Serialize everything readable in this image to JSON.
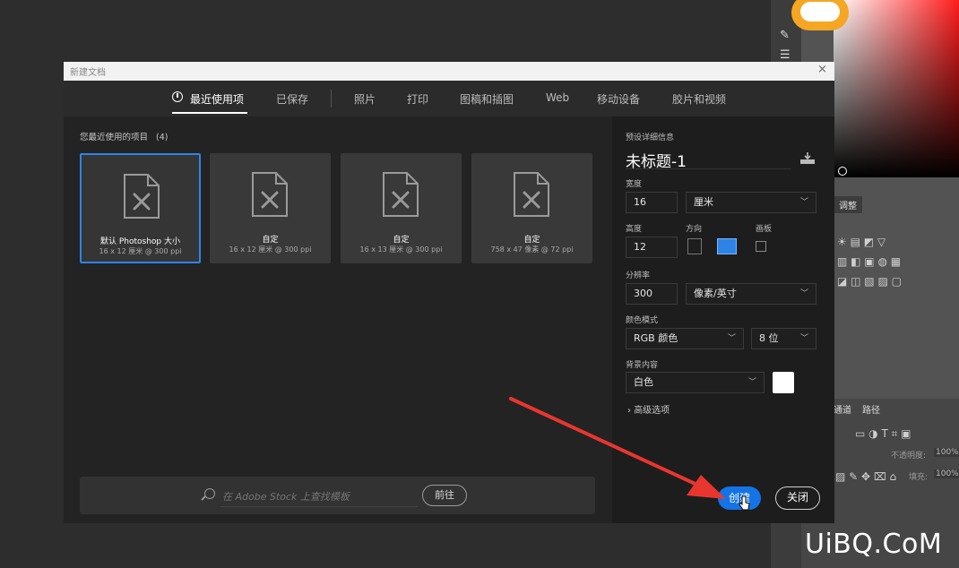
{
  "dialog": {
    "title": "新建文档",
    "close_glyph": "×"
  },
  "tabs": [
    {
      "label": "最近使用项",
      "active": true
    },
    {
      "label": "已保存"
    },
    {
      "label": "照片"
    },
    {
      "label": "打印"
    },
    {
      "label": "图稿和插图"
    },
    {
      "label": "Web"
    },
    {
      "label": "移动设备"
    },
    {
      "label": "胶片和视频"
    }
  ],
  "recent": {
    "heading": "您最近使用的项目",
    "count": "(4)",
    "items": [
      {
        "name": "默认 Photoshop 大小",
        "size": "16 x 12 厘米 @ 300 ppi",
        "selected": true
      },
      {
        "name": "自定",
        "size": "16 x 12 厘米 @ 300 ppi"
      },
      {
        "name": "自定",
        "size": "16 x 13 厘米 @ 300 ppi"
      },
      {
        "name": "自定",
        "size": "758 x 47 像素 @ 72 ppi"
      }
    ]
  },
  "search": {
    "placeholder": "在 Adobe Stock 上查找模板",
    "go_label": "前往"
  },
  "preset": {
    "section_label": "预设详细信息",
    "doc_name": "未标题-1",
    "width_label": "宽度",
    "width_value": "16",
    "width_unit": "厘米",
    "height_label": "高度",
    "height_value": "12",
    "orientation_label": "方向",
    "artboard_label": "画板",
    "resolution_label": "分辨率",
    "resolution_value": "300",
    "resolution_unit": "像素/英寸",
    "color_mode_label": "颜色模式",
    "color_mode_value": "RGB 颜色",
    "bit_depth_value": "8 位",
    "background_label": "背景内容",
    "background_value": "白色",
    "background_color": "#ffffff",
    "advanced_label": "高级选项"
  },
  "buttons": {
    "create": "创建",
    "close": "关闭"
  },
  "photoshop_panels": {
    "adjust_tab": "调整",
    "channels_tab": "通道",
    "paths_tab": "路径",
    "opacity_label": "不透明度:",
    "opacity_value": "100%",
    "fill_label": "填充:",
    "fill_value": "100%"
  },
  "watermark": "UiBQ.CoM",
  "colors": {
    "accent": "#1473e6",
    "selected_border": "#2e84e6",
    "arrow": "#e8362f"
  }
}
